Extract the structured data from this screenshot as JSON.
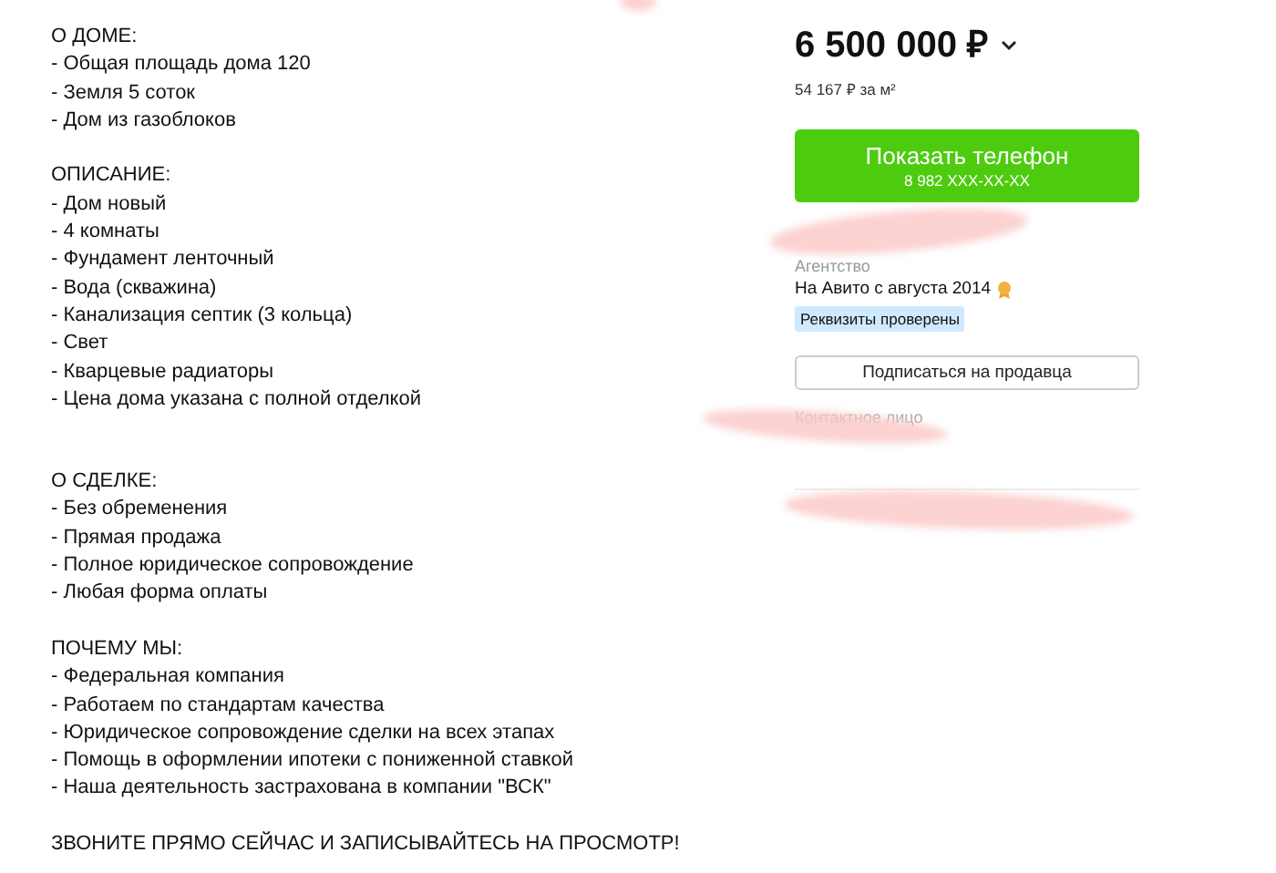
{
  "description": {
    "sections": [
      {
        "heading": "О ДОМЕ:",
        "lines": [
          "- Общая площадь дома 120",
          "- Земля 5 соток",
          "- Дом из газоблоков"
        ]
      },
      {
        "heading": "ОПИСАНИЕ:",
        "lines": [
          "- Дом новый",
          "- 4 комнаты",
          "- Фундамент ленточный",
          "- Вода (скважина)",
          "- Канализация септик (3 кольца)",
          "- Свет",
          "- Кварцевые радиаторы",
          "- Цена дома указана с полной отделкой"
        ]
      },
      {
        "heading": "О СДЕЛКЕ:",
        "lines": [
          "- Без обременения",
          "- Прямая продажа",
          "- Полное юридическое сопровождение",
          "- Любая форма оплаты"
        ]
      },
      {
        "heading": "ПОЧЕМУ МЫ:",
        "lines": [
          "- Федеральная компания",
          "- Работаем по стандартам качества",
          "- Юридическое сопровождение сделки на всех этапах",
          "- Помощь в оформлении ипотеки с пониженной ставкой",
          "- Наша деятельность застрахована в компании \"ВСК\""
        ]
      },
      {
        "heading": "ЗВОНИТЕ ПРЯМО СЕЙЧАС И ЗАПИСЫВАЙТЕСЬ НА ПРОСМОТР!"
      }
    ]
  },
  "sidebar": {
    "price": "6 500 000 ₽",
    "price_per_m2": "54 167 ₽ за м²",
    "show_phone_button": {
      "label": "Показать телефон",
      "phone": "8 982 XXX-XX-XX"
    },
    "seller_type": "Агентство",
    "member_since": "На Авито с августа 2014",
    "verified_badge": "Реквизиты проверены",
    "subscribe_button": "Подписаться на продавца",
    "contact_label": "Контактное лицо"
  }
}
